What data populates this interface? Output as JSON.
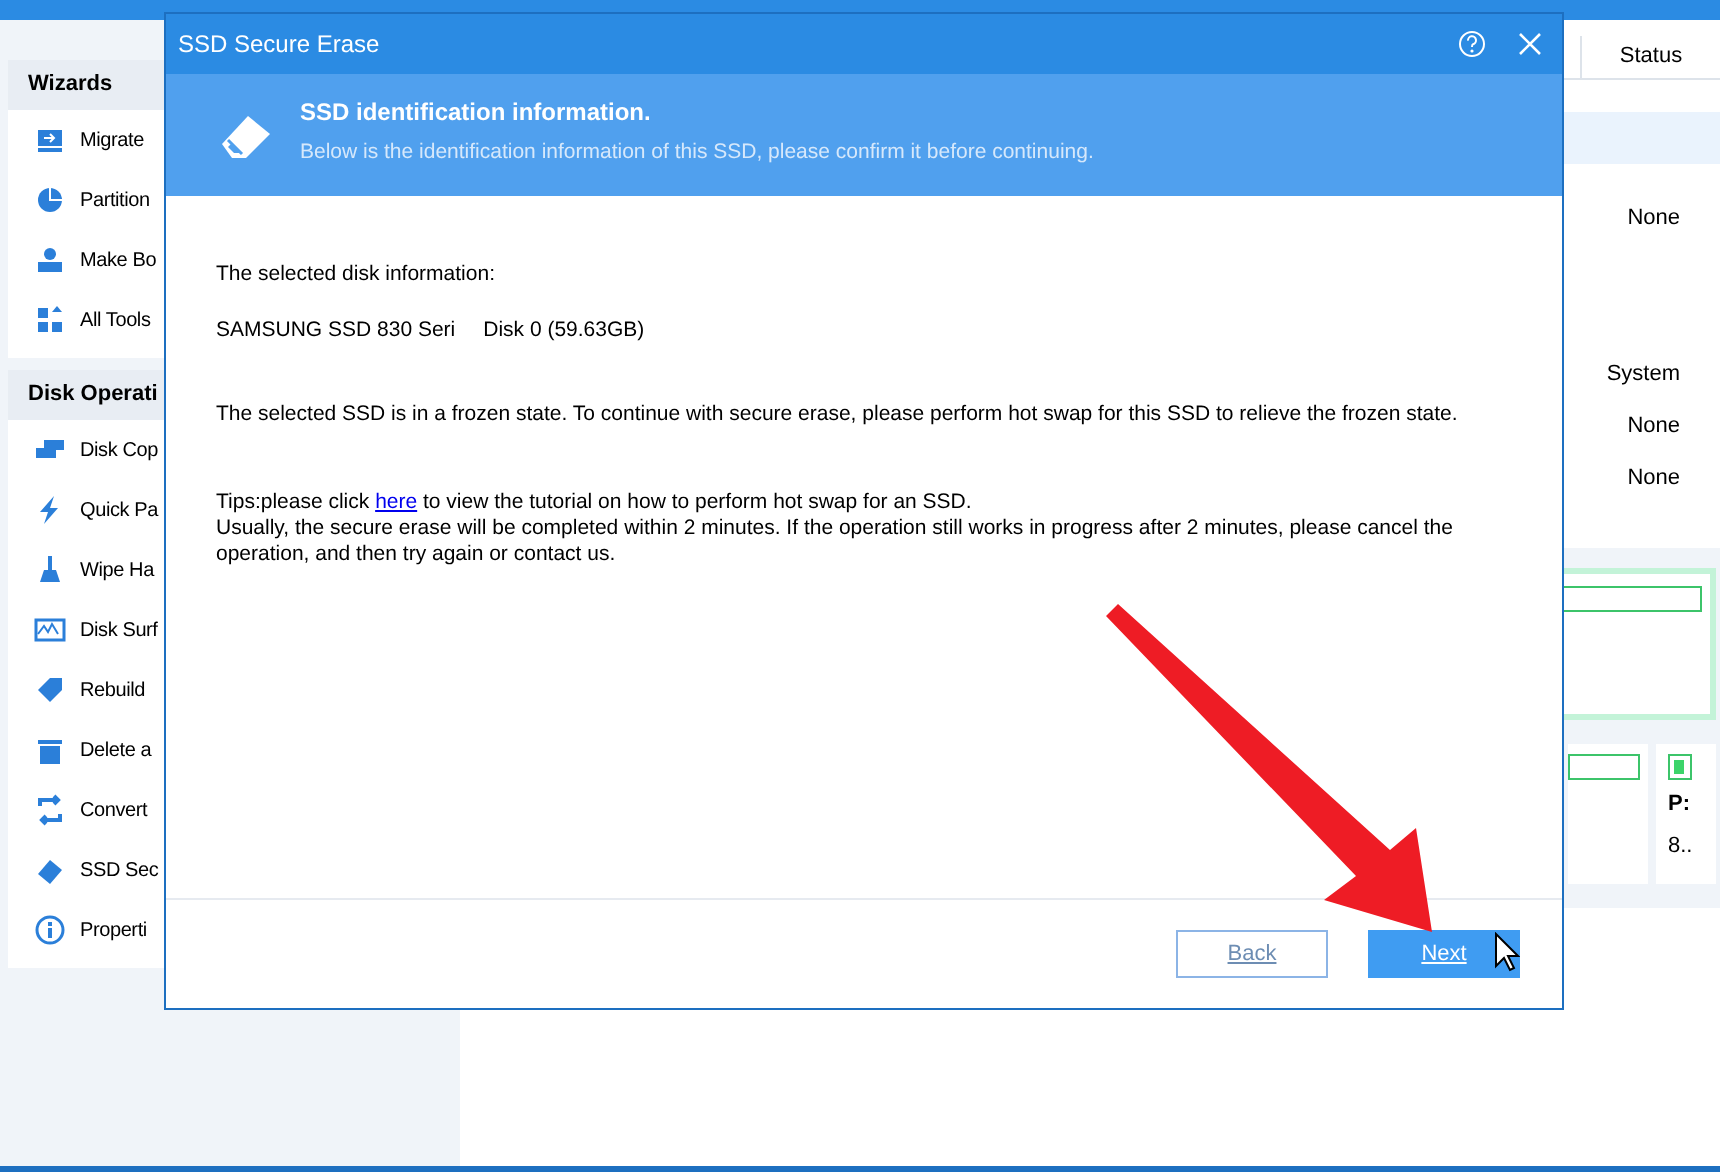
{
  "sidebar": {
    "sections": [
      {
        "title": "Wizards",
        "items": [
          "Migrate",
          "Partition",
          "Make Bo",
          "All Tools"
        ]
      },
      {
        "title": "Disk Operati",
        "items": [
          "Disk Cop",
          "Quick Pa",
          "Wipe Ha",
          "Disk Surf",
          "Rebuild",
          "Delete a",
          "Convert",
          "SSD Sec",
          "Properti"
        ]
      }
    ]
  },
  "table": {
    "columns": [
      "Status"
    ],
    "rows": [
      {
        "selected": true
      },
      {
        "status": "None",
        "selected": false
      },
      {
        "selected": false
      },
      {
        "selected": false
      },
      {
        "status": "System",
        "selected": false
      },
      {
        "status": "None",
        "selected": false
      },
      {
        "status": "None",
        "selected": false
      }
    ]
  },
  "disk_map": {
    "partition_label": "P:",
    "partition_size": "8.."
  },
  "dialog": {
    "title": "SSD Secure Erase",
    "header_title": "SSD identification information.",
    "header_subtitle": "Below is the identification information of this SSD, please confirm it before continuing.",
    "disk_info_label": "The selected disk information:",
    "disk_model": "SAMSUNG SSD 830 Seri",
    "disk_name": "Disk 0 (59.63GB)",
    "frozen_message": "The selected SSD is in a frozen state. To continue with secure erase, please perform hot swap for this SSD to relieve the frozen state.",
    "tips_before": "Tips:please click",
    "tips_link": "here",
    "tips_after": "to view the tutorial on how to perform hot swap for an SSD.",
    "note": "Usually, the secure erase will be completed within 2 minutes. If the operation still works in progress after 2 minutes, please cancel the operation, and then try again or contact us.",
    "buttons": [
      {
        "label": "Back",
        "kind": "secondary"
      },
      {
        "label": "Next",
        "kind": "primary"
      }
    ]
  }
}
